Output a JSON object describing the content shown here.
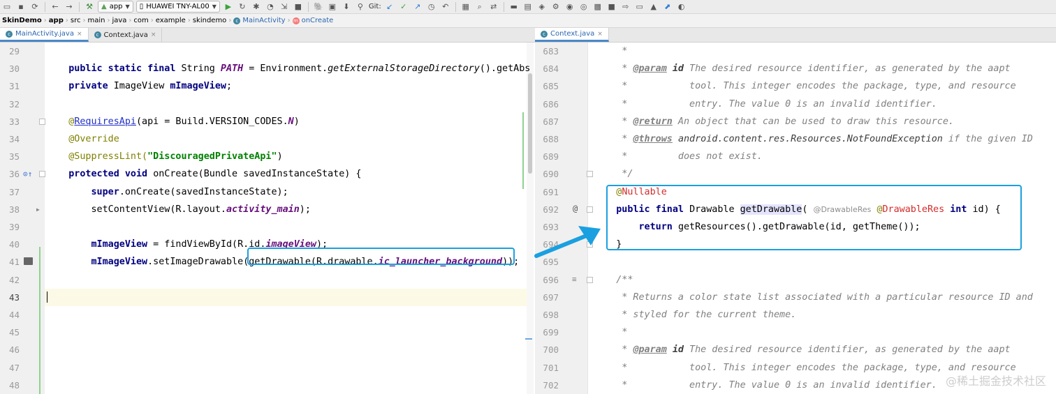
{
  "toolbar": {
    "run_config": "app",
    "device": "HUAWEI TNY-AL00",
    "vcs_label": "Git:"
  },
  "breadcrumb": [
    {
      "label": "SkinDemo",
      "kind": "bold"
    },
    {
      "label": "app",
      "kind": "bold"
    },
    {
      "label": "src",
      "kind": "plain"
    },
    {
      "label": "main",
      "kind": "plain"
    },
    {
      "label": "java",
      "kind": "plain"
    },
    {
      "label": "com",
      "kind": "plain"
    },
    {
      "label": "example",
      "kind": "plain"
    },
    {
      "label": "skindemo",
      "kind": "plain"
    },
    {
      "label": "MainActivity",
      "kind": "class"
    },
    {
      "label": "onCreate",
      "kind": "method"
    }
  ],
  "left_tabs": [
    {
      "label": "MainActivity.java",
      "active": true
    },
    {
      "label": "Context.java",
      "active": false
    }
  ],
  "right_tabs": [
    {
      "label": "Context.java",
      "active": true
    }
  ],
  "left_editor": {
    "current_line": "43",
    "lines": [
      {
        "num": "29",
        "segs": []
      },
      {
        "num": "30",
        "segs": [
          {
            "t": "    public static final ",
            "c": "kw"
          },
          {
            "t": "String ",
            "c": ""
          },
          {
            "t": "PATH",
            "c": "fld"
          },
          {
            "t": " = Environment.",
            "c": ""
          },
          {
            "t": "getExternalStorageDirectory",
            "c": "ital"
          },
          {
            "t": "().getAbs",
            "c": ""
          }
        ]
      },
      {
        "num": "31",
        "segs": [
          {
            "t": "    private ",
            "c": "kw"
          },
          {
            "t": "ImageView ",
            "c": ""
          },
          {
            "t": "mImageView",
            "c": "kw"
          },
          {
            "t": ";",
            "c": ""
          }
        ]
      },
      {
        "num": "32",
        "segs": []
      },
      {
        "num": "33",
        "segs": [
          {
            "t": "    @",
            "c": "ann"
          },
          {
            "t": "RequiresApi",
            "c": "link"
          },
          {
            "t": "(api = Build.VERSION_CODES.",
            "c": ""
          },
          {
            "t": "N",
            "c": "fld"
          },
          {
            "t": ")",
            "c": ""
          }
        ]
      },
      {
        "num": "34",
        "segs": [
          {
            "t": "    @Override",
            "c": "ann"
          }
        ]
      },
      {
        "num": "35",
        "segs": [
          {
            "t": "    @SuppressLint(",
            "c": "ann"
          },
          {
            "t": "\"DiscouragedPrivateApi\"",
            "c": "str"
          },
          {
            "t": ")",
            "c": ""
          }
        ]
      },
      {
        "num": "36",
        "segs": [
          {
            "t": "    protected void ",
            "c": "kw"
          },
          {
            "t": "onCreate(Bundle savedInstanceState) {",
            "c": ""
          }
        ]
      },
      {
        "num": "37",
        "segs": [
          {
            "t": "        super",
            "c": "kw"
          },
          {
            "t": ".onCreate(savedInstanceState);",
            "c": ""
          }
        ]
      },
      {
        "num": "38",
        "segs": [
          {
            "t": "        setContentView(R.layout.",
            "c": ""
          },
          {
            "t": "activity_main",
            "c": "fld"
          },
          {
            "t": ");",
            "c": ""
          }
        ]
      },
      {
        "num": "39",
        "segs": []
      },
      {
        "num": "40",
        "segs": [
          {
            "t": "        mImageView",
            "c": "kw"
          },
          {
            "t": " = findViewById(R.id.",
            "c": ""
          },
          {
            "t": "imageView",
            "c": "fld"
          },
          {
            "t": ");",
            "c": ""
          }
        ]
      },
      {
        "num": "41",
        "segs": [
          {
            "t": "        mImageView",
            "c": "kw"
          },
          {
            "t": ".setImageDrawable(",
            "c": ""
          },
          {
            "t": "getDrawable(R.drawable.",
            "c": ""
          },
          {
            "t": "ic_launcher_background",
            "c": "fld"
          },
          {
            "t": ")",
            "c": ""
          },
          {
            "t": ");",
            "c": ""
          }
        ]
      },
      {
        "num": "42",
        "segs": []
      },
      {
        "num": "43",
        "segs": []
      },
      {
        "num": "44",
        "segs": []
      },
      {
        "num": "45",
        "segs": []
      },
      {
        "num": "46",
        "segs": []
      },
      {
        "num": "47",
        "segs": []
      },
      {
        "num": "48",
        "segs": []
      }
    ]
  },
  "right_editor": {
    "lines": [
      {
        "num": "683",
        "segs": [
          {
            "t": "     *",
            "c": "cmt"
          }
        ]
      },
      {
        "num": "684",
        "segs": [
          {
            "t": "     * ",
            "c": "cmt"
          },
          {
            "t": "@param",
            "c": "tag"
          },
          {
            "t": " ",
            "c": "cmt"
          },
          {
            "t": "id",
            "c": "cmtid"
          },
          {
            "t": " The desired resource identifier, as generated by the aapt",
            "c": "cmt"
          }
        ]
      },
      {
        "num": "685",
        "segs": [
          {
            "t": "     *           tool. This integer encodes the package, type, and resource",
            "c": "cmt"
          }
        ]
      },
      {
        "num": "686",
        "segs": [
          {
            "t": "     *           entry. The value 0 is an invalid identifier.",
            "c": "cmt"
          }
        ]
      },
      {
        "num": "687",
        "segs": [
          {
            "t": "     * ",
            "c": "cmt"
          },
          {
            "t": "@return",
            "c": "tag"
          },
          {
            "t": " An object that can be used to draw this resource.",
            "c": "cmt"
          }
        ]
      },
      {
        "num": "688",
        "segs": [
          {
            "t": "     * ",
            "c": "cmt"
          },
          {
            "t": "@throws",
            "c": "tag"
          },
          {
            "t": " ",
            "c": "cmt"
          },
          {
            "t": "android.content.res.Resources.NotFoundException",
            "c": "cmtcode"
          },
          {
            "t": " if the given ID",
            "c": "cmt"
          }
        ]
      },
      {
        "num": "689",
        "segs": [
          {
            "t": "     *         does not exist.",
            "c": "cmt"
          }
        ]
      },
      {
        "num": "690",
        "segs": [
          {
            "t": "     */",
            "c": "cmt"
          }
        ]
      },
      {
        "num": "691",
        "segs": [
          {
            "t": "    @",
            "c": "ann"
          },
          {
            "t": "Nullable",
            "c": "red"
          }
        ]
      },
      {
        "num": "692",
        "segs": [
          {
            "t": "    public final ",
            "c": "kw"
          },
          {
            "t": "Drawable ",
            "c": ""
          },
          {
            "t": "getDrawable",
            "c": "hl"
          },
          {
            "t": "( ",
            "c": ""
          },
          {
            "t": "@DrawableRes",
            "c": "hint"
          },
          {
            "t": " ",
            "c": ""
          },
          {
            "t": "@",
            "c": "ann"
          },
          {
            "t": "DrawableRes",
            "c": "red"
          },
          {
            "t": " int ",
            "c": "kw"
          },
          {
            "t": "id) {",
            "c": ""
          }
        ]
      },
      {
        "num": "693",
        "segs": [
          {
            "t": "        return ",
            "c": "kw"
          },
          {
            "t": "getResources().getDrawable(id, getTheme());",
            "c": ""
          }
        ]
      },
      {
        "num": "694",
        "segs": [
          {
            "t": "    }",
            "c": ""
          }
        ]
      },
      {
        "num": "695",
        "segs": []
      },
      {
        "num": "696",
        "segs": [
          {
            "t": "    /**",
            "c": "cmt"
          }
        ]
      },
      {
        "num": "697",
        "segs": [
          {
            "t": "     * Returns a color state list associated with a particular resource ID and",
            "c": "cmt"
          }
        ]
      },
      {
        "num": "698",
        "segs": [
          {
            "t": "     * styled for the current theme.",
            "c": "cmt"
          }
        ]
      },
      {
        "num": "699",
        "segs": [
          {
            "t": "     *",
            "c": "cmt"
          }
        ]
      },
      {
        "num": "700",
        "segs": [
          {
            "t": "     * ",
            "c": "cmt"
          },
          {
            "t": "@param",
            "c": "tag"
          },
          {
            "t": " ",
            "c": "cmt"
          },
          {
            "t": "id",
            "c": "cmtid"
          },
          {
            "t": " The desired resource identifier, as generated by the aapt",
            "c": "cmt"
          }
        ]
      },
      {
        "num": "701",
        "segs": [
          {
            "t": "     *           tool. This integer encodes the package, type, and resource",
            "c": "cmt"
          }
        ]
      },
      {
        "num": "702",
        "segs": [
          {
            "t": "     *           entry. The value 0 is an invalid identifier.",
            "c": "cmt"
          }
        ]
      }
    ]
  },
  "watermark": "@稀土掘金技术社区",
  "colors": {
    "callout": "#1aa0e0",
    "keyword": "#000080",
    "annotation": "#808000",
    "comment": "#808080"
  }
}
